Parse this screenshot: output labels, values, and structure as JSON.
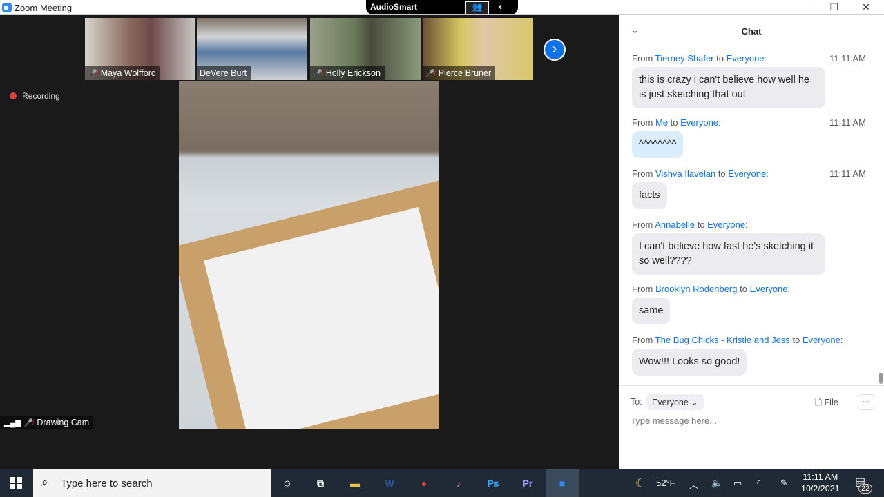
{
  "window": {
    "title": "Zoom Meeting",
    "audiosmart": "AudioSmart"
  },
  "participants": [
    {
      "name": "Maya Wolfford",
      "muted": true
    },
    {
      "name": "DeVere Burt",
      "muted": false
    },
    {
      "name": "Holly Erickson",
      "muted": true
    },
    {
      "name": "Pierce Bruner",
      "muted": true
    }
  ],
  "recording": "Recording",
  "main_video": {
    "name": "Drawing Cam",
    "muted": true
  },
  "chat": {
    "title": "Chat",
    "messages": [
      {
        "from": "Tierney Shafer",
        "to": "Everyone",
        "time": "11:11 AM",
        "text": "this is crazy i can't believe how well he is just sketching that out",
        "me": false
      },
      {
        "from": "Me",
        "to": "Everyone",
        "time": "11:11 AM",
        "text": "^^^^^^^^",
        "me": true
      },
      {
        "from": "Vishva Ilavelan",
        "to": "Everyone",
        "time": "11:11 AM",
        "text": "facts",
        "me": false
      },
      {
        "from": "Annabelle",
        "to": "Everyone",
        "time": "",
        "text": "I can't believe how fast he's sketching it so well????",
        "me": false
      },
      {
        "from": "Brooklyn Rodenberg",
        "to": "Everyone",
        "time": "",
        "text": "same",
        "me": false
      },
      {
        "from": "The Bug Chicks - Kristie and Jess",
        "to": "Everyone",
        "time": "",
        "text": "Wow!!! Looks so good!",
        "me": false
      }
    ],
    "from_word": "From",
    "to_word": "to",
    "to_label": "To:",
    "recipient": "Everyone",
    "file_label": "File",
    "placeholder": "Type message here..."
  },
  "taskbar": {
    "search_placeholder": "Type here to search",
    "weather": "52°F",
    "time": "11:11 AM",
    "date": "10/2/2021",
    "notifications": "22",
    "apps": [
      {
        "name": "word",
        "label": "W",
        "color": "#2b579a"
      },
      {
        "name": "chrome",
        "label": "●",
        "color": "#db4437"
      },
      {
        "name": "itunes",
        "label": "♪",
        "color": "#f25c8c"
      },
      {
        "name": "photoshop",
        "label": "Ps",
        "color": "#31a8ff"
      },
      {
        "name": "premiere",
        "label": "Pr",
        "color": "#9999ff"
      },
      {
        "name": "zoom",
        "label": "■",
        "color": "#2d8cff"
      }
    ]
  }
}
